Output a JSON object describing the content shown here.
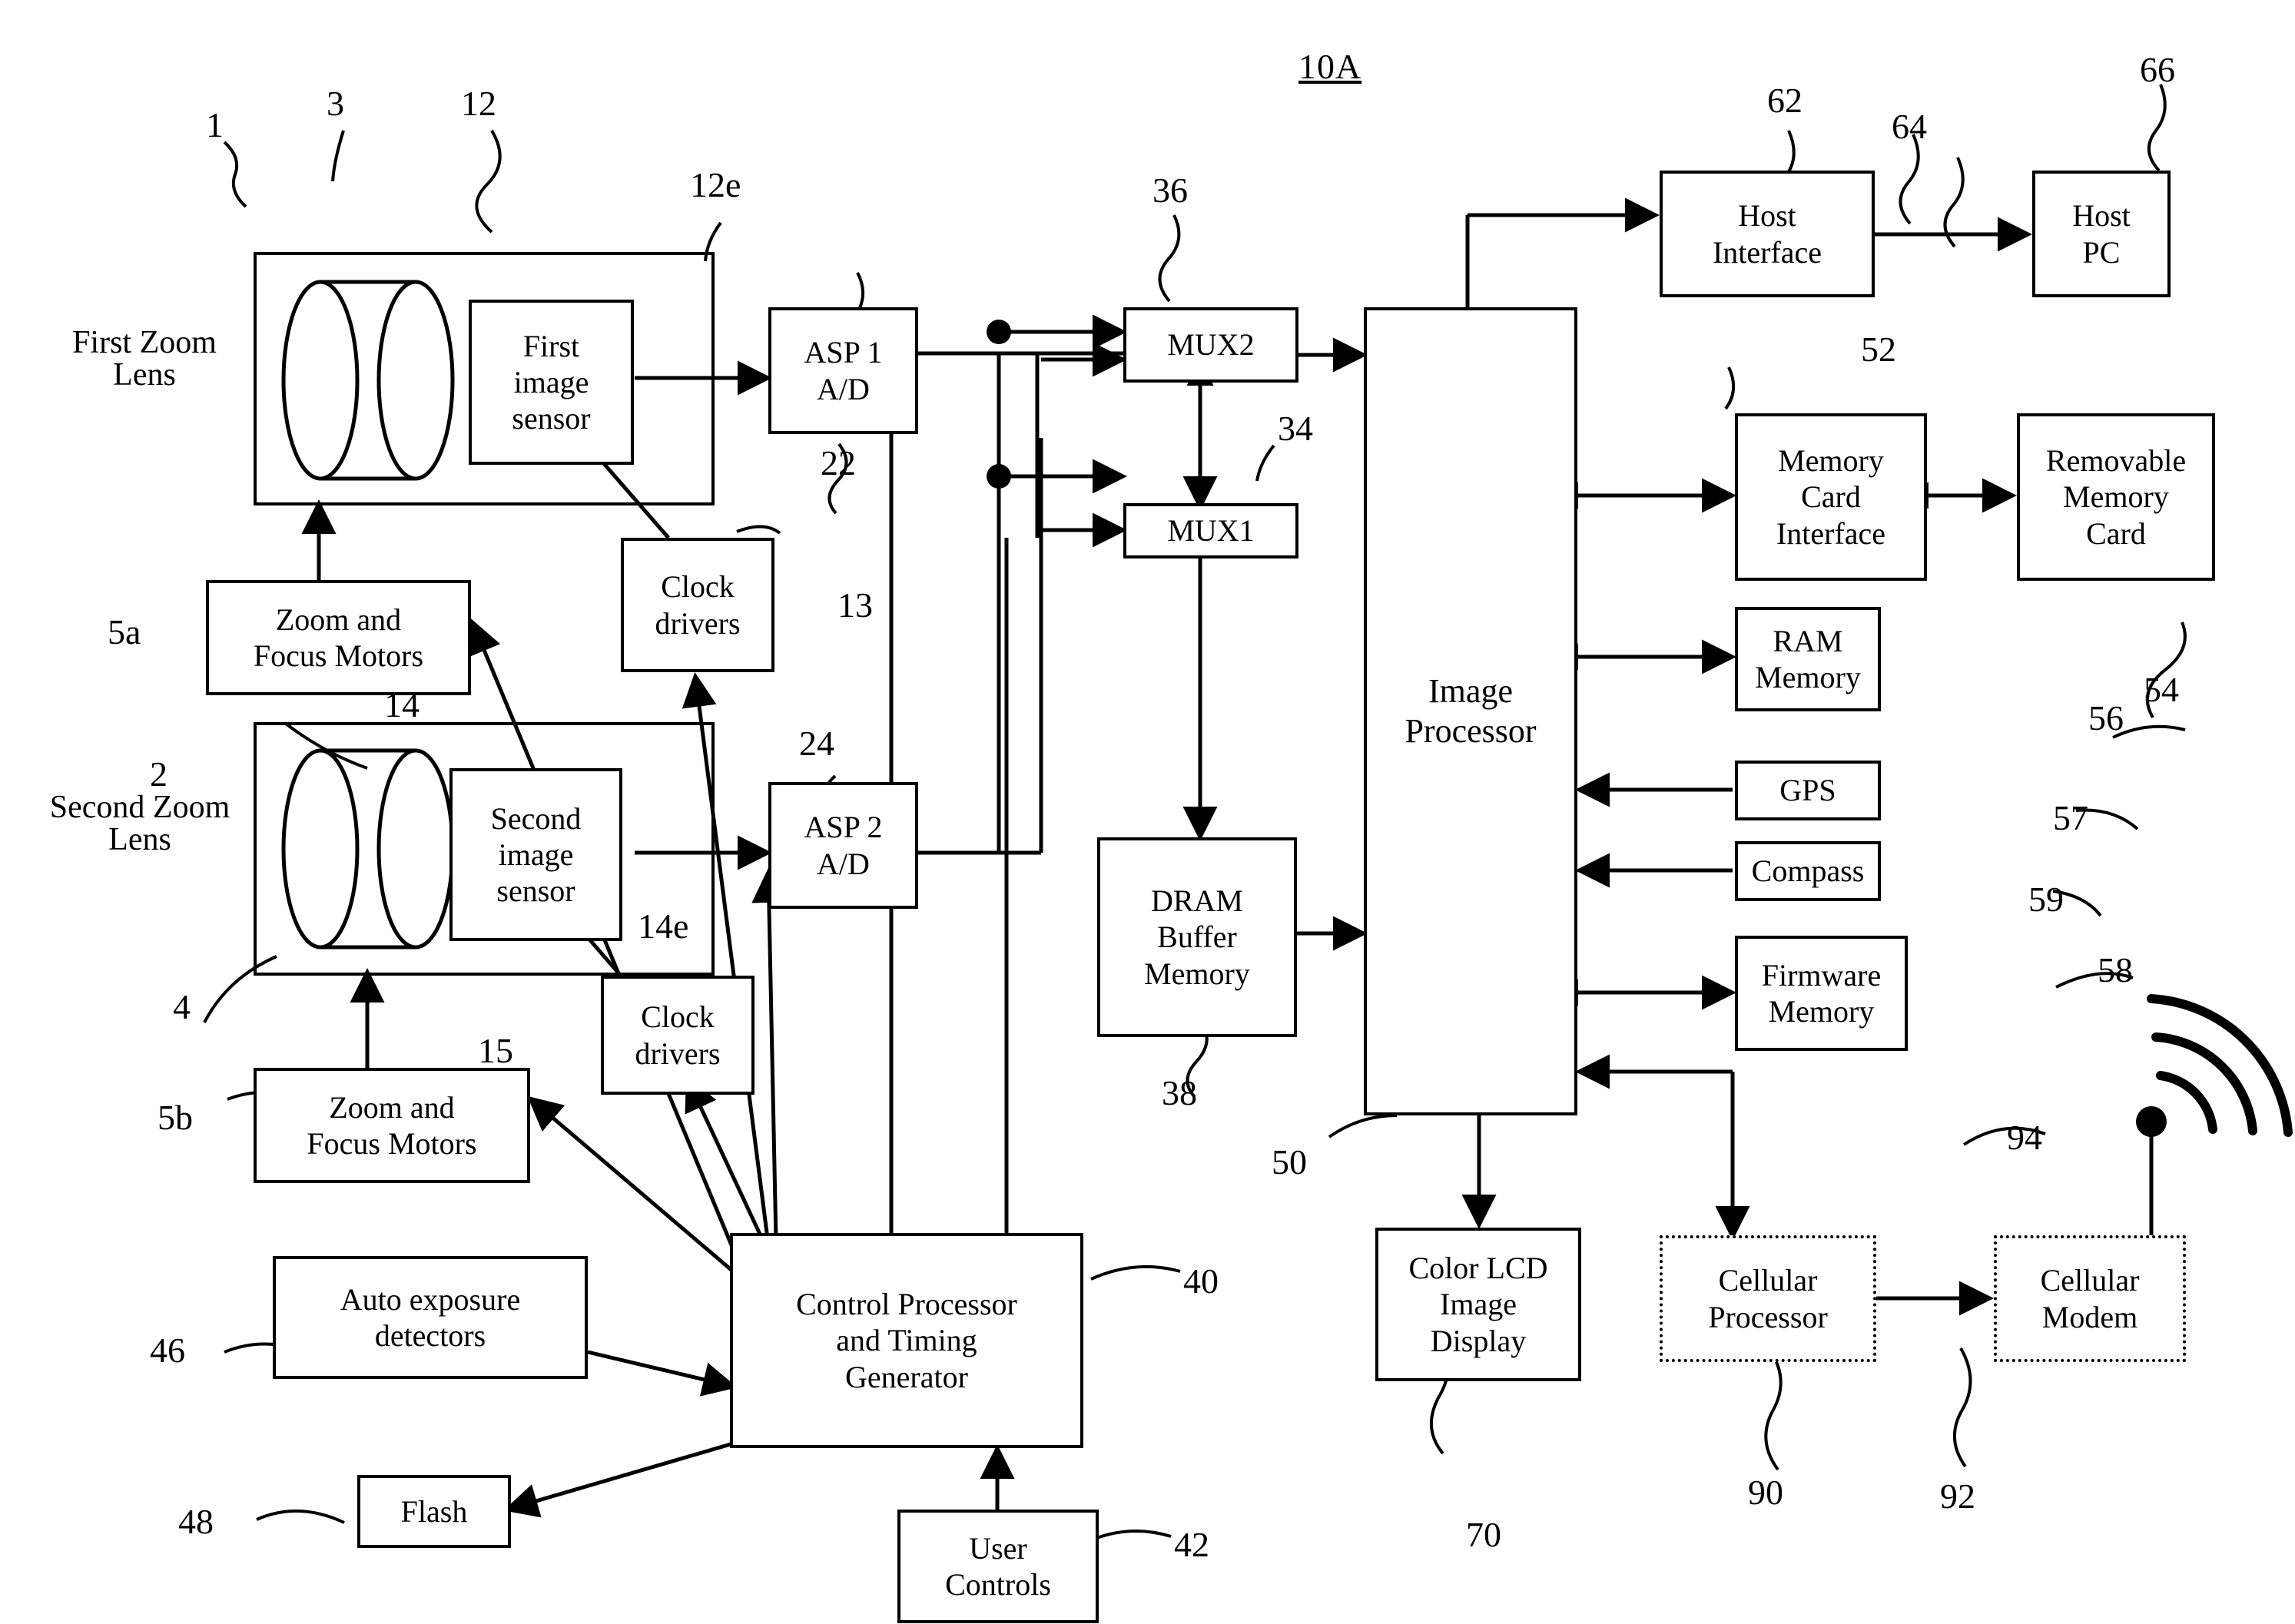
{
  "figure": {
    "title": "10A"
  },
  "blocks": {
    "first_zoom_lens_label": "First Zoom\nLens",
    "second_zoom_lens_label": "Second Zoom\nLens",
    "first_image_sensor": "First\nimage\nsensor",
    "second_image_sensor": "Second\nimage\nsensor",
    "asp1": "ASP 1\nA/D",
    "asp2": "ASP 2\nA/D",
    "mux2": "MUX2",
    "mux1": "MUX1",
    "dram_buffer_memory": "DRAM\nBuffer\nMemory",
    "image_processor": "Image\nProcessor",
    "host_interface": "Host\nInterface",
    "host_pc": "Host\nPC",
    "memory_card_interface": "Memory\nCard\nInterface",
    "removable_memory_card": "Removable\nMemory\nCard",
    "ram_memory": "RAM\nMemory",
    "gps": "GPS",
    "compass": "Compass",
    "firmware_memory": "Firmware\nMemory",
    "color_lcd_image_display": "Color LCD\nImage\nDisplay",
    "cellular_processor": "Cellular\nProcessor",
    "cellular_modem": "Cellular\nModem",
    "zoom_focus_motors_a": "Zoom and\nFocus Motors",
    "zoom_focus_motors_b": "Zoom and\nFocus Motors",
    "clock_drivers_13": "Clock\ndrivers",
    "clock_drivers_15": "Clock\ndrivers",
    "auto_exposure_detectors": "Auto exposure\ndetectors",
    "flash": "Flash",
    "control_processor": "Control Processor\nand Timing\nGenerator",
    "user_controls": "User\nControls"
  },
  "reference_numerals": {
    "n1": "1",
    "n2": "2",
    "n3": "3",
    "n4": "4",
    "n5a": "5a",
    "n5b": "5b",
    "n12": "12",
    "n12e": "12e",
    "n13": "13",
    "n14": "14",
    "n14e": "14e",
    "n15": "15",
    "n22": "22",
    "n24": "24",
    "n34": "34",
    "n36": "36",
    "n38": "38",
    "n40": "40",
    "n42": "42",
    "n46": "46",
    "n48": "48",
    "n50": "50",
    "n52": "52",
    "n54": "54",
    "n56": "56",
    "n57": "57",
    "n58": "58",
    "n59": "59",
    "n62": "62",
    "n64": "64",
    "n66": "66",
    "n70": "70",
    "n90": "90",
    "n92": "92",
    "n94": "94"
  }
}
